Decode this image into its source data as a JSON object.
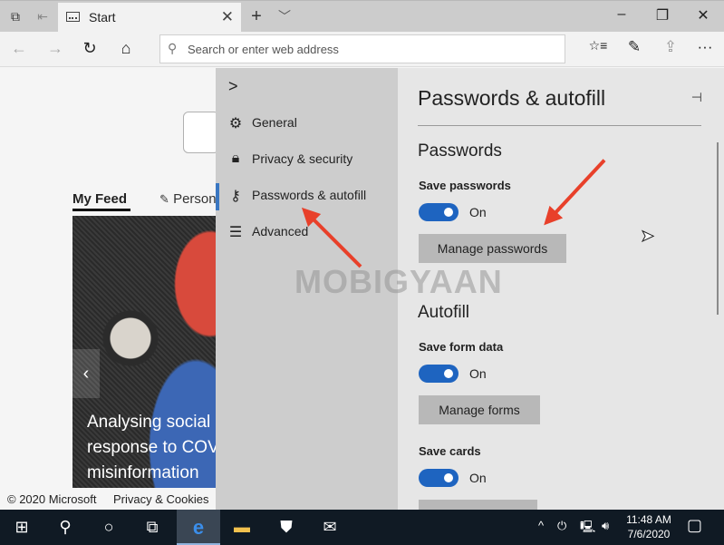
{
  "browser": {
    "tab": {
      "title": "Start",
      "icon": "start-page-icon"
    },
    "tab_actions": {
      "new_tab": "+",
      "tab_list": "⌵"
    },
    "window_controls": {
      "minimize": "–",
      "restore": "❐",
      "close": "✕"
    },
    "address_bar": {
      "placeholder": "Search or enter web address"
    },
    "nav": {
      "back": "←",
      "forward": "→",
      "refresh": "↻",
      "home": "⌂"
    },
    "toolbar": {
      "favorites": "☆≡",
      "notes": "✎",
      "share": "⇪",
      "more": "···"
    }
  },
  "page": {
    "feed_tabs": [
      {
        "label": "My Feed",
        "active": true
      },
      {
        "label": "Personalize",
        "visible_text": "Person",
        "icon": "pencil-icon"
      }
    ],
    "headline": [
      "Analysing social",
      "response to COV",
      "misinformation"
    ],
    "footer": {
      "copyright": "© 2020 Microsoft",
      "privacy": "Privacy & Cookies"
    }
  },
  "settings_nav": {
    "collapse": ">",
    "items": [
      {
        "label": "General",
        "icon": "gear-icon",
        "glyph": "⚙",
        "active": false
      },
      {
        "label": "Privacy & security",
        "icon": "lock-icon",
        "glyph": "🔒︎",
        "active": false
      },
      {
        "label": "Passwords & autofill",
        "icon": "key-icon",
        "glyph": "⚷",
        "active": true
      },
      {
        "label": "Advanced",
        "icon": "sliders-icon",
        "glyph": "☰",
        "active": false
      }
    ]
  },
  "settings_panel": {
    "title": "Passwords & autofill",
    "pin": "⊣",
    "sections": [
      {
        "heading": "Passwords",
        "settings": [
          {
            "label": "Save passwords",
            "toggle": true,
            "state_text": "On",
            "button": "Manage passwords"
          }
        ]
      },
      {
        "heading": "Autofill",
        "settings": [
          {
            "label": "Save form data",
            "toggle": true,
            "state_text": "On",
            "button": "Manage forms"
          },
          {
            "label": "Save cards",
            "toggle": true,
            "state_text": "On",
            "button": ""
          }
        ]
      }
    ],
    "colors": {
      "toggle_on": "#1e64c0",
      "active_indicator": "#3a77c2"
    }
  },
  "watermark": "MOBIGYAAN",
  "taskbar": {
    "items": [
      "start",
      "search",
      "cortana",
      "task-view",
      "edge",
      "file-explorer",
      "store",
      "mail"
    ],
    "glyphs": {
      "start": "⊞",
      "search": "⚲",
      "cortana": "○",
      "taskview": "⧉",
      "edge": "e",
      "explorer": "▬",
      "store": "⛊",
      "mail": "✉"
    },
    "tray": {
      "chevron": "^",
      "power": "⏻",
      "network": "🖳︎",
      "volume": "🔊︎",
      "notifications": "▢"
    },
    "time": "11:48 AM",
    "date": "7/6/2020"
  }
}
